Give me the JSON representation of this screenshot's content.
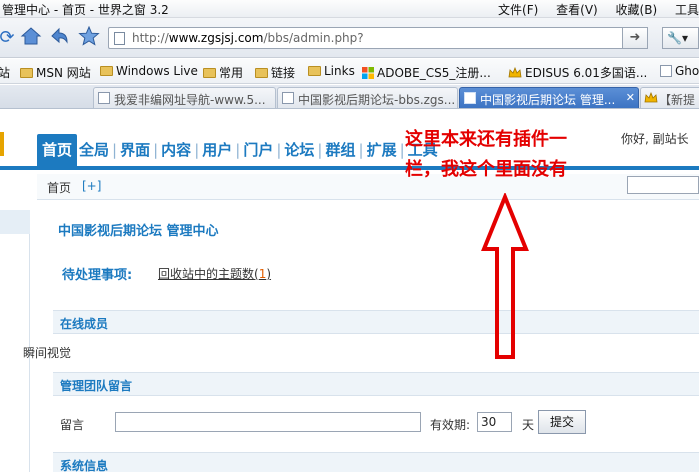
{
  "window": {
    "title": "管理中心 - 首页 - 世界之窗 3.2",
    "menu": [
      "文件(F)",
      "查看(V)",
      "收藏(B)",
      "工具"
    ]
  },
  "nav": {
    "url_domain": "www.zgsjsj.com",
    "url_prefix": "http://",
    "url_path": "/bbs/admin.php?"
  },
  "bookmarks": [
    {
      "label": "站",
      "icon": "folder-icon"
    },
    {
      "label": "MSN 网站",
      "icon": "folder-icon"
    },
    {
      "label": "Windows Live",
      "icon": "folder-icon"
    },
    {
      "label": "常用",
      "icon": "folder-icon"
    },
    {
      "label": "链接",
      "icon": "folder-icon"
    },
    {
      "label": "Links",
      "icon": "folder-icon"
    },
    {
      "label": "ADOBE_CS5_注册...",
      "icon": "windows-icon"
    },
    {
      "label": "EDISUS 6.01多国语...",
      "icon": "crown-icon"
    },
    {
      "label": "Ghos",
      "icon": "page-icon"
    }
  ],
  "tabs": [
    {
      "label": "我爱非编网址导航-www.5...",
      "active": false
    },
    {
      "label": "中国影视后期论坛-bbs.zgs...",
      "active": false
    },
    {
      "label": "中国影视后期论坛 管理...",
      "active": true
    },
    {
      "label": "【新提",
      "active": false
    }
  ],
  "admin": {
    "top_tabs": [
      "首页",
      "全局",
      "界面",
      "内容",
      "用户",
      "门户",
      "论坛",
      "群组",
      "扩展",
      "工具"
    ],
    "greeting": "你好, 副站长",
    "breadcrumb": "首页",
    "breadcrumb_add": "[+]",
    "page_title": "中国影视后期论坛 管理中心",
    "pending_label": "待处理事项:",
    "pending_item": "回收站中的主题数",
    "pending_count_open": "(",
    "pending_count": "1",
    "pending_count_close": ")",
    "section_online": "在线成员",
    "online_user": "瞬间视觉",
    "section_team_msg": "管理团队留言",
    "msg_label": "留言",
    "valid_label": "有效期:",
    "valid_value": "30",
    "day_label": "天",
    "submit_label": "提交",
    "section_sysinfo": "系统信息"
  },
  "annotation": {
    "line1": "这里本来还有插件一",
    "line2": "栏，我这个里面没有",
    "color": "#e40000"
  }
}
